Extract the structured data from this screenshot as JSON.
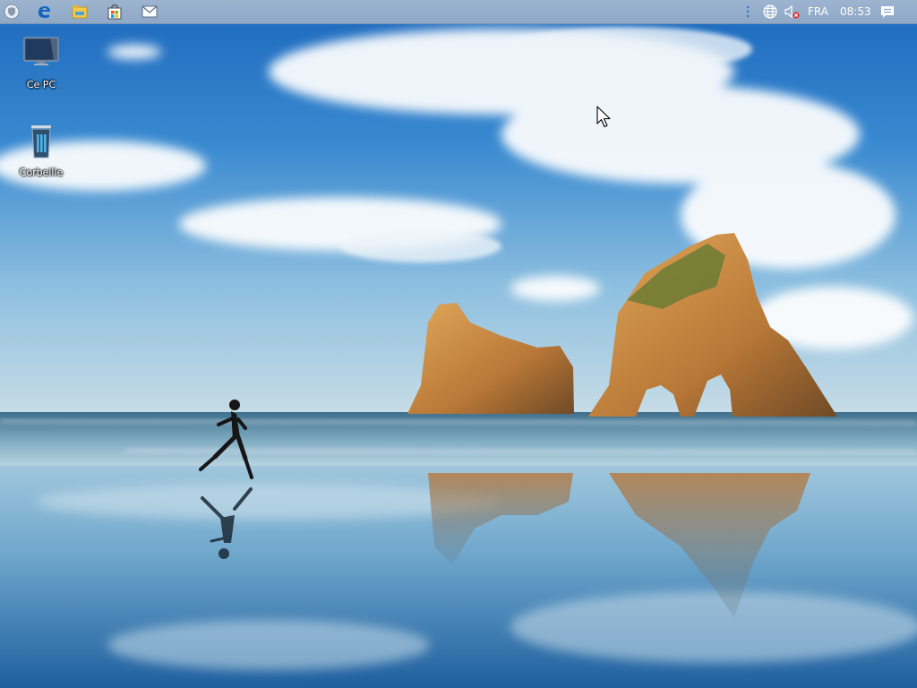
{
  "taskbar": {
    "left_icons": [
      {
        "name": "start-shield-icon"
      },
      {
        "name": "edge-browser-icon"
      },
      {
        "name": "file-explorer-icon"
      },
      {
        "name": "store-icon"
      },
      {
        "name": "mail-icon"
      }
    ],
    "tray": {
      "network_icon": "globe-icon",
      "volume_icon": "speaker-muted-icon",
      "language": "FRA",
      "time": "08:53",
      "notifications_icon": "action-center-icon"
    }
  },
  "desktop": {
    "icons": [
      {
        "label": "Ce PC",
        "icon": "computer-monitor-icon"
      },
      {
        "label": "Corbeille",
        "icon": "recycle-bin-icon"
      }
    ]
  },
  "colors": {
    "taskbar": "#93aecb",
    "sky_top": "#1f6fc0",
    "sea": "#6aa6c8",
    "rock": "#c98a45"
  }
}
